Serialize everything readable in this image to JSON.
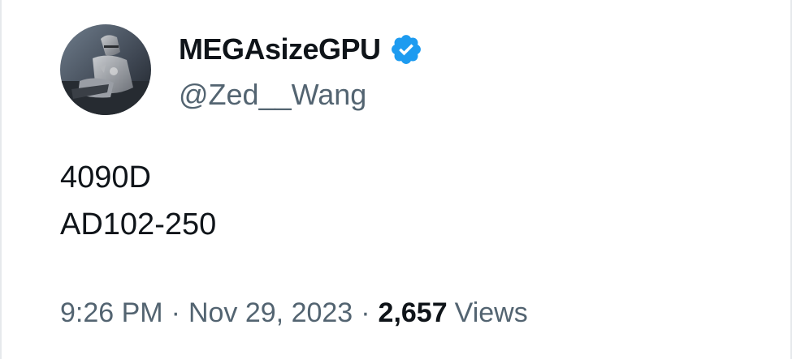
{
  "author": {
    "display_name": "MEGAsizeGPU",
    "handle": "@Zed__Wang",
    "verified": true,
    "verified_color": "#1d9bf0"
  },
  "tweet": {
    "lines": [
      "4090D",
      "AD102-250"
    ]
  },
  "meta": {
    "time": "9:26 PM",
    "separator": "·",
    "date": "Nov 29, 2023",
    "views_count": "2,657",
    "views_label": "Views"
  },
  "icons": {
    "avatar": "avatar-knight-image",
    "verified": "verified-badge-icon"
  }
}
